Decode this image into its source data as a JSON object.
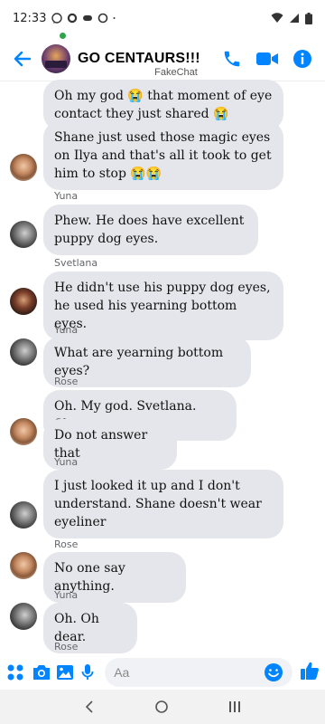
{
  "status_bar": {
    "time": "12:33"
  },
  "header": {
    "title": "GO CENTAURS!!!",
    "watermark": "FakeChat"
  },
  "messages": [
    {
      "sender": "",
      "text": "Oh my god 😭 that moment of eye contact they just shared 😭"
    },
    {
      "sender": "",
      "text": "Shane just used those magic eyes on Ilya and that's all it took to get him to stop 😭😭"
    },
    {
      "sender": "Yuna",
      "text": "Phew. He does have excellent puppy dog eyes."
    },
    {
      "sender": "Svetlana",
      "text": "He didn't use his puppy dog eyes, he used his yearning bottom eyes."
    },
    {
      "sender": "Yuna",
      "text": "What are yearning bottom eyes?"
    },
    {
      "sender": "Rose",
      "text": "Oh. My god. Svetlana. Shut up"
    },
    {
      "sender": "",
      "text": "Do not answer that"
    },
    {
      "sender": "Yuna",
      "text": "I just looked it up and I don't understand. Shane doesn't wear eyeliner"
    },
    {
      "sender": "Rose",
      "text": "No one say anything."
    },
    {
      "sender": "Yuna",
      "text": "Oh. Oh dear."
    },
    {
      "sender": "Rose",
      "text": ""
    }
  ],
  "composer": {
    "placeholder": "Aa"
  },
  "colors": {
    "accent": "#0084ff",
    "bubble": "#e4e6eb",
    "online": "#31a24c"
  }
}
